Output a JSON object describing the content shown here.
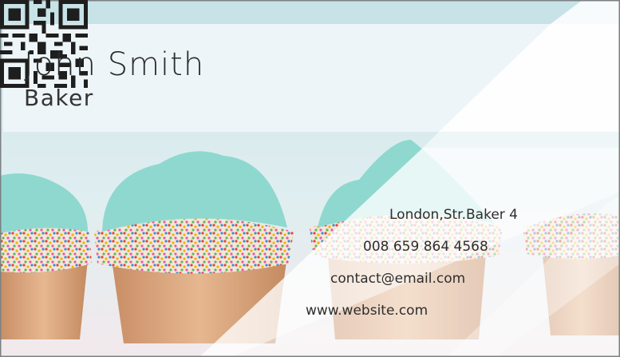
{
  "card": {
    "name": "John Smith",
    "title": "Baker",
    "address": "London,Str.Baker 4",
    "phone": "008 659 864 4568",
    "email": "contact@email.com",
    "website": "www.website.com"
  },
  "colors": {
    "header_band": "#eef4f7",
    "top_strip": "#bfe0e6",
    "background": "#cfe4e8",
    "frosting": "#8fd8cf",
    "cupcake_liner": "#d9a27a",
    "text": "#2b2b2b"
  },
  "icons": {
    "qr": "qr-code-icon"
  }
}
